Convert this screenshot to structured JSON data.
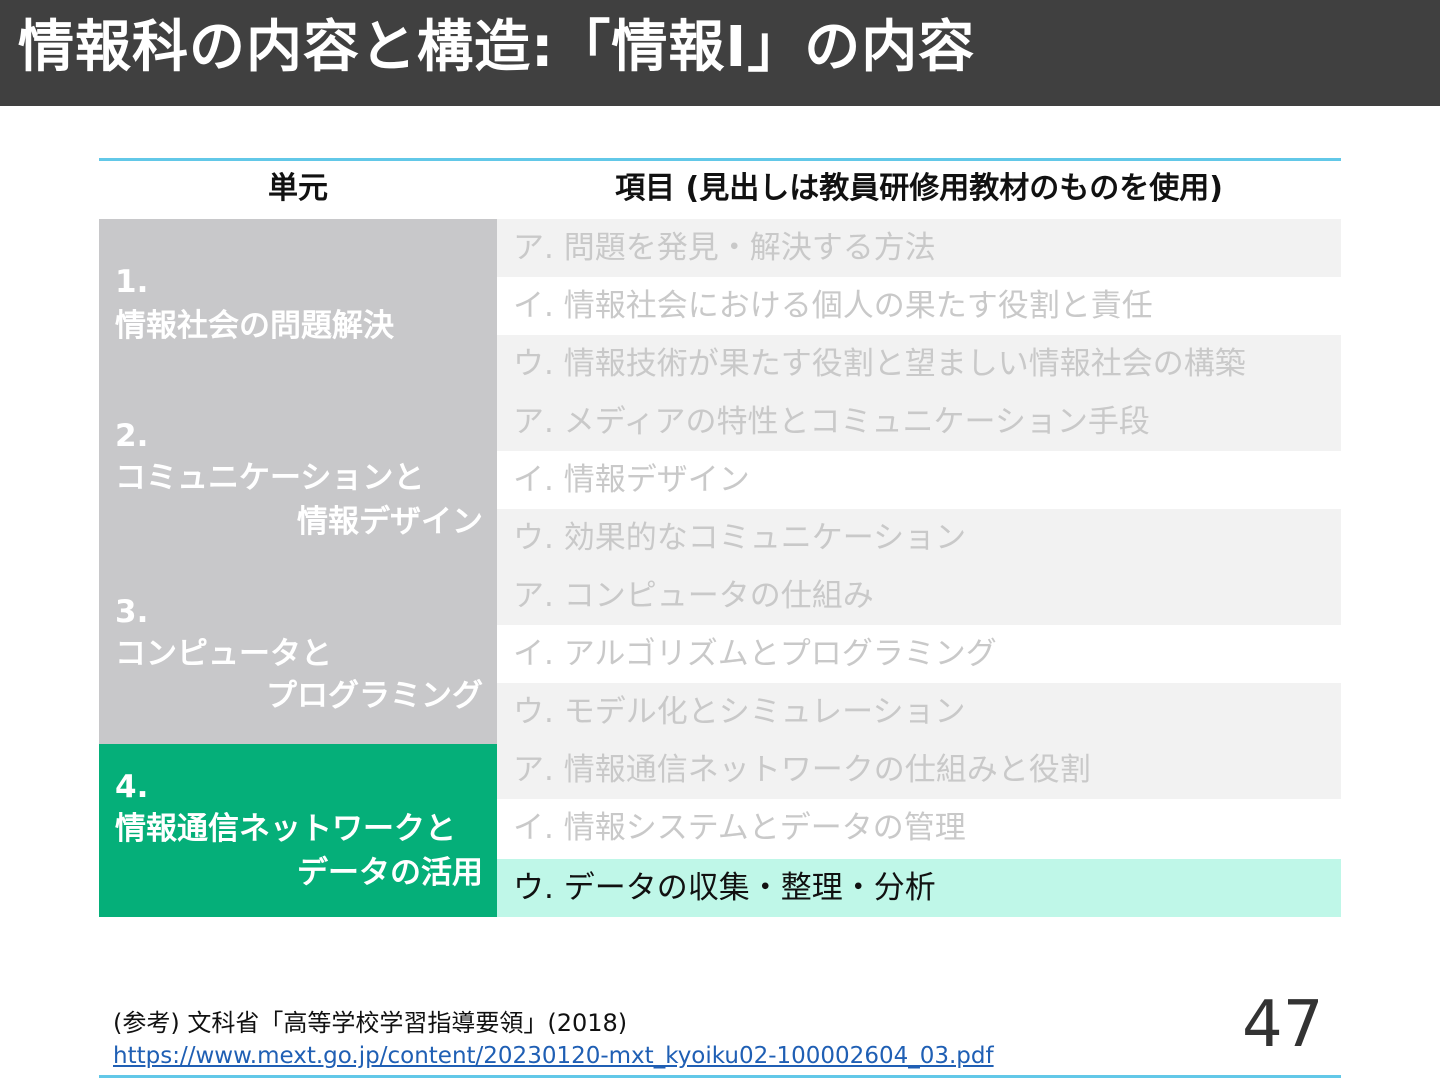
{
  "slide": {
    "title": "情報科の内容と構造:「情報I」の内容",
    "page_number": "47"
  },
  "table": {
    "header_unit": "単元",
    "header_item": "項目 (見出しは教員研修用教材のものを使用)",
    "units": [
      {
        "number": "1.",
        "line1": "情報社会の問題解決",
        "line2": ""
      },
      {
        "number": "2.",
        "line1": "コミュニケーションと",
        "line2": "情報デザイン"
      },
      {
        "number": "3.",
        "line1": "コンピュータと",
        "line2": "プログラミング"
      },
      {
        "number": "4.",
        "line1": "情報通信ネットワークと",
        "line2": "データの活用"
      }
    ],
    "rows": [
      "ア. 問題を発見・解決する方法",
      "イ. 情報社会における個人の果たす役割と責任",
      "ウ. 情報技術が果たす役割と望ましい情報社会の構築",
      "ア. メディアの特性とコミュニケーション手段",
      "イ. 情報デザイン",
      "ウ. 効果的なコミュニケーション",
      "ア. コンピュータの仕組み",
      "イ. アルゴリズムとプログラミング",
      "ウ. モデル化とシミュレーション",
      "ア. 情報通信ネットワークの仕組みと役割",
      "イ. 情報システムとデータの管理",
      "ウ. データの収集・整理・分析"
    ]
  },
  "reference": {
    "citation": "(参考) 文科省「高等学校学習指導要領」(2018)",
    "url": "https://www.mext.go.jp/content/20230120-mxt_kyoiku02-100002604_03.pdf"
  },
  "colors": {
    "title_bar": "#404040",
    "unit_gray": "#c8c8ca",
    "unit_green": "#05af79",
    "row_highlight": "#bff7e8",
    "rule_line": "#62c8e8"
  }
}
